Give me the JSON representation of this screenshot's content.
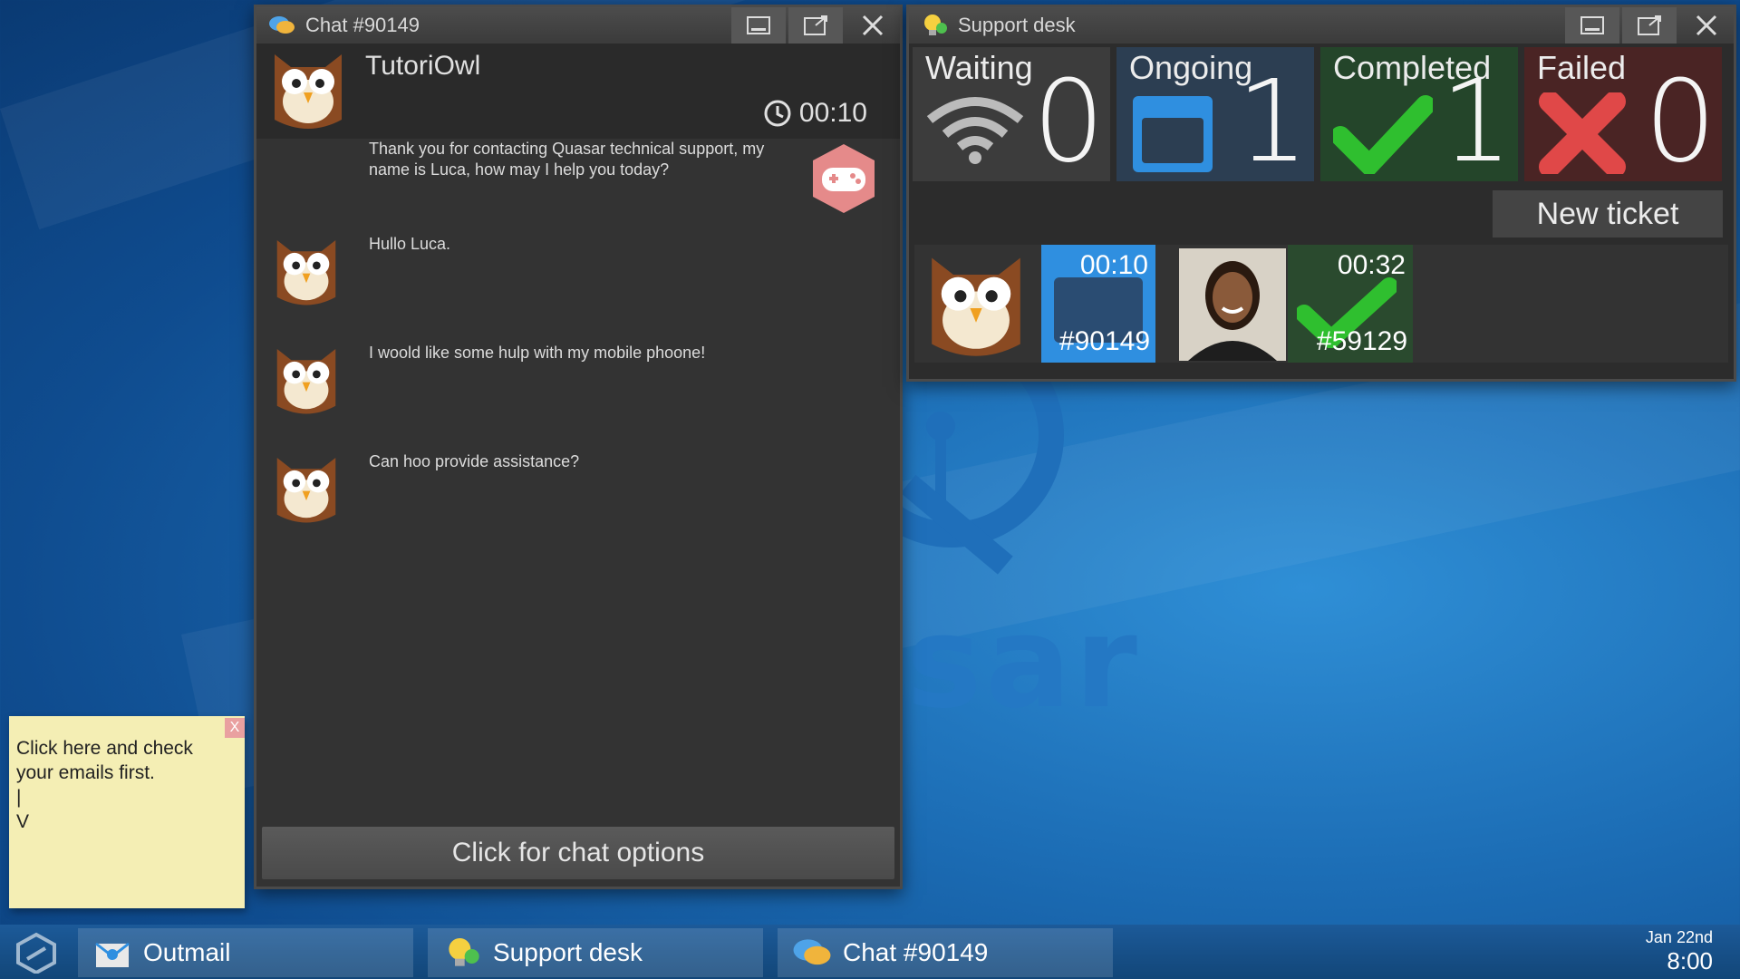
{
  "chat_window": {
    "title": "Chat #90149",
    "contact_name": "TutoriOwl",
    "timer": "00:10",
    "messages": [
      {
        "text": "Thank you for contacting Quasar technical support, my name is Luca, how may I help you today?",
        "from": "agent"
      },
      {
        "text": "Hullo Luca.",
        "from": "customer"
      },
      {
        "text": "I woold like some hulp with my mobile phoone!",
        "from": "customer"
      },
      {
        "text": "Can hoo provide assistance?",
        "from": "customer"
      }
    ],
    "options_label": "Click for chat options"
  },
  "support_window": {
    "title": "Support desk",
    "stats": [
      {
        "label": "Waiting",
        "count": "0",
        "color": "#3c3c3c",
        "icon": "wifi-icon"
      },
      {
        "label": "Ongoing",
        "count": "1",
        "color": "#2c3e52",
        "icon": "window-icon"
      },
      {
        "label": "Completed",
        "count": "1",
        "color": "#24452a",
        "icon": "check-icon"
      },
      {
        "label": "Failed",
        "count": "0",
        "color": "#4a2424",
        "icon": "cross-icon"
      }
    ],
    "new_ticket_label": "New ticket",
    "tickets": [
      {
        "time": "00:10",
        "id": "#90149",
        "status": "ongoing",
        "status_color": "#2f8fe0"
      },
      {
        "time": "00:32",
        "id": "#59129",
        "status": "completed",
        "status_color": "#2fbf2f"
      }
    ]
  },
  "sticky_note": {
    "text": "Click here and check\nyour emails first.\n|\nV",
    "close_label": "X"
  },
  "taskbar": {
    "items": [
      {
        "label": "Outmail"
      },
      {
        "label": "Support desk"
      },
      {
        "label": "Chat #90149"
      }
    ],
    "date": "Jan 22nd",
    "time": "8:00"
  },
  "wallpaper": {
    "brand_text": "sar"
  }
}
